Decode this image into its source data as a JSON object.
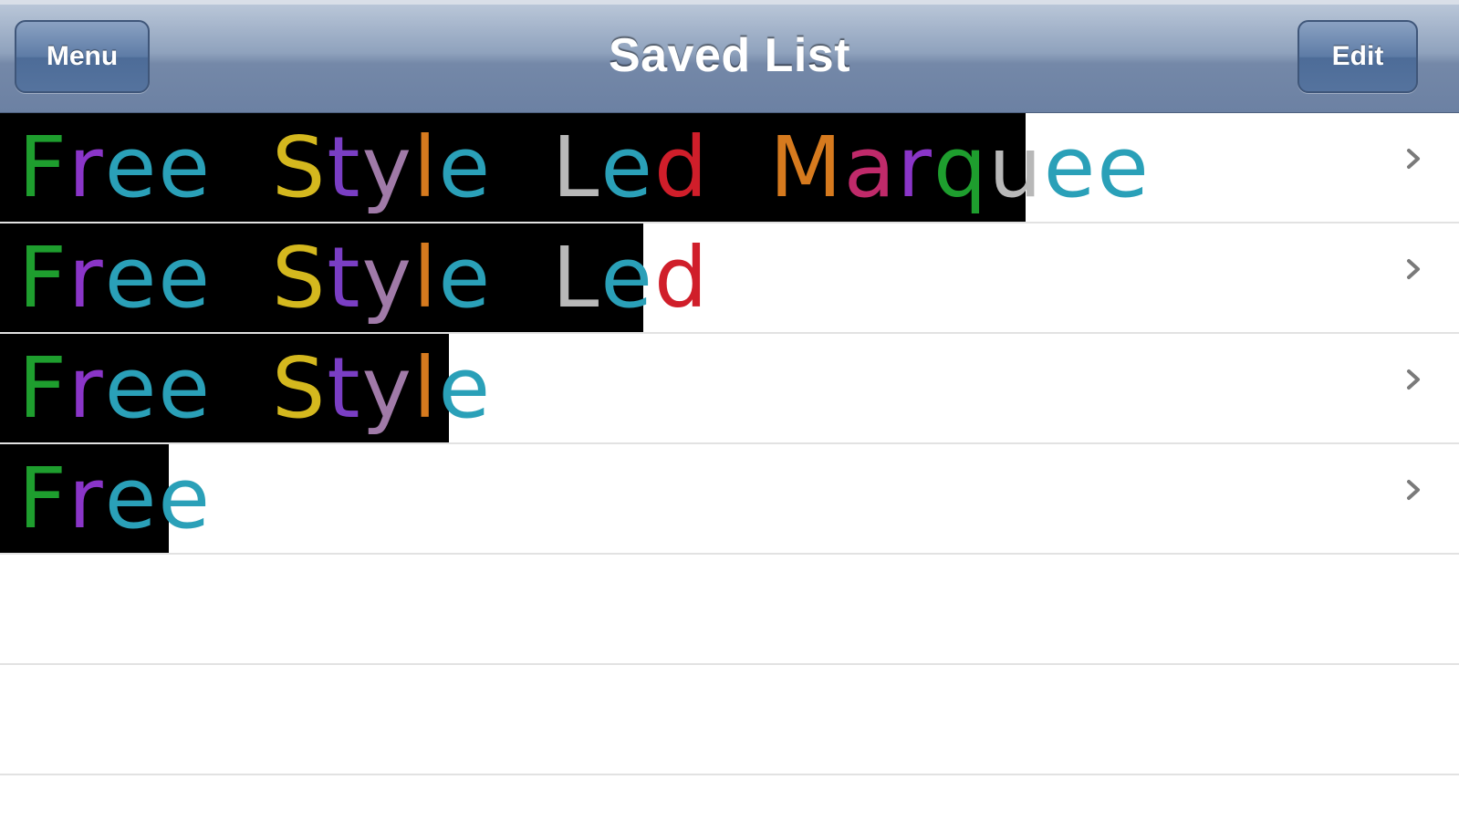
{
  "nav": {
    "title": "Saved List",
    "left_button": "Menu",
    "right_button": "Edit"
  },
  "letter_colors": {
    "F": "#1e9e2e",
    "r": "#8a35c8",
    "e": "#2aa0b8",
    "S": "#d4b81e",
    "t": "#7a3ec4",
    "y": "#a07aa8",
    "l": "#d67a1e",
    "L": "#b8b8b8",
    "d": "#d01e2a",
    "M": "#d67a1e",
    "a": "#c02a6a",
    "q": "#1e9e2e",
    "u": "#b8b8b8"
  },
  "saved_items": [
    {
      "text": "Free Style Led Marquee",
      "preview_width_fraction": 0.703
    },
    {
      "text": "Free Style Led",
      "preview_width_fraction": 0.441
    },
    {
      "text": "Free Style",
      "preview_width_fraction": 0.308
    },
    {
      "text": "Free",
      "preview_width_fraction": 0.116
    }
  ],
  "icons": {
    "row_accessory": "chevron-right-icon"
  }
}
